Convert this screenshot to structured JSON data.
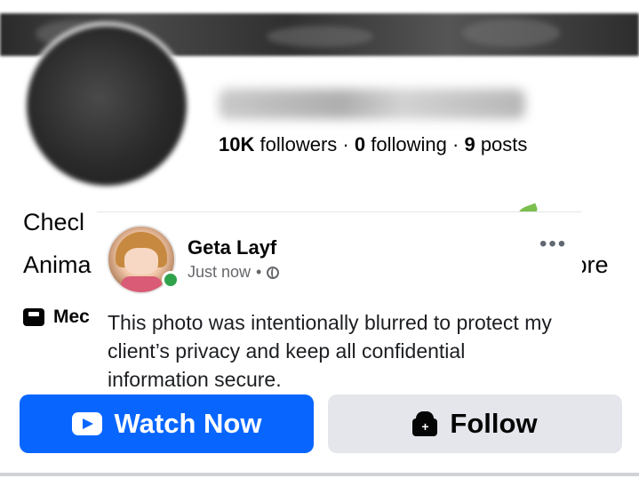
{
  "profile": {
    "stats": {
      "followers_count": "10K",
      "followers_label": "followers",
      "sep1": "·",
      "following_count": "0",
      "following_label": "following",
      "sep2": "·",
      "posts_count": "9",
      "posts_label": "posts"
    },
    "bio_line1": "Checl",
    "bio_line2": "Anima",
    "bio_more": "ɔre",
    "media_label": "Mec"
  },
  "post": {
    "author": "Geta Layf",
    "time": "Just now",
    "time_sep": "•",
    "more": "•••",
    "text": "This photo was intentionally blurred to protect my client’s privacy and keep all confidential information secure."
  },
  "actions": {
    "watch_label": "Watch Now",
    "follow_label": "Follow"
  },
  "colors": {
    "primary": "#0866ff",
    "secondary_button": "#e4e6eb",
    "online": "#31a24c"
  },
  "icons": {
    "watch": "play-icon",
    "follow": "follow-icon",
    "privacy": "globe-icon",
    "media": "media-icon"
  }
}
